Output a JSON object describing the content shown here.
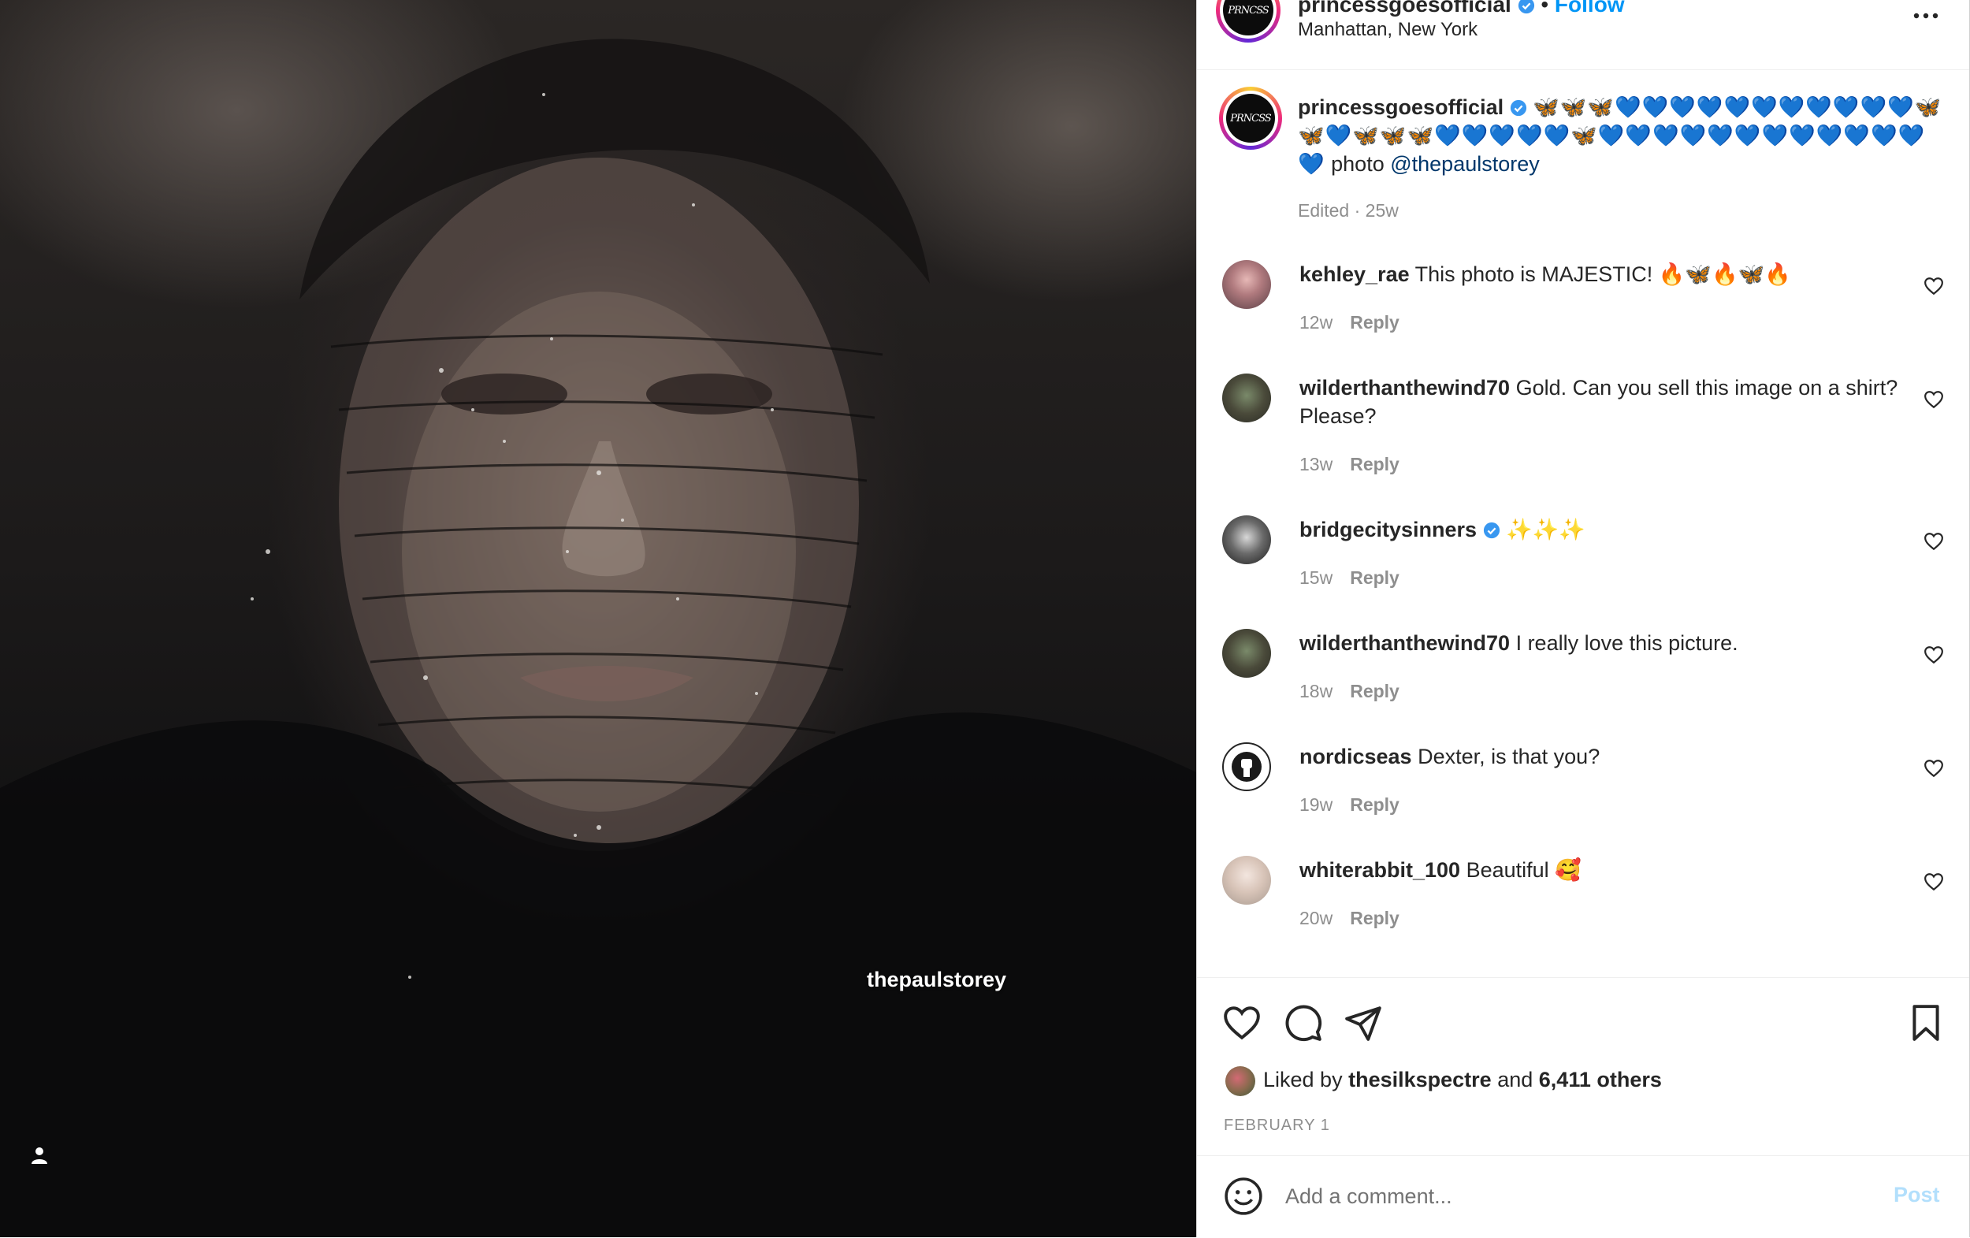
{
  "post": {
    "photo_credit": "thepaulstorey"
  },
  "author": {
    "username": "princessgoesofficial",
    "follow_label": "Follow",
    "location": "Manhattan, New York",
    "logo_text": "PRNCSS"
  },
  "caption": {
    "username": "princessgoesofficial",
    "emojis": "🦋🦋🦋💙💙💙💙💙💙💙💙💙💙💙🦋🦋💙🦋🦋🦋💙💙💙💙💙🦋💙💙💙💙💙💙💙💙💙💙💙💙💙",
    "text": "photo",
    "mention": "@thepaulstorey",
    "meta": "Edited · 25w"
  },
  "comments": [
    {
      "username": "kehley_rae",
      "text": "This photo is MAJESTIC! 🔥🦋🔥🦋🔥",
      "time": "12w",
      "reply": "Reply",
      "verified": false
    },
    {
      "username": "wilderthanthewind70",
      "text": "Gold. Can you sell this image on a shirt? Please?",
      "time": "13w",
      "reply": "Reply",
      "verified": false
    },
    {
      "username": "bridgecitysinners",
      "text": "✨✨✨",
      "time": "15w",
      "reply": "Reply",
      "verified": true
    },
    {
      "username": "wilderthanthewind70",
      "text": "I really love this picture.",
      "time": "18w",
      "reply": "Reply",
      "verified": false
    },
    {
      "username": "nordicseas",
      "text": "Dexter, is that you?",
      "time": "19w",
      "reply": "Reply",
      "verified": false
    },
    {
      "username": "whiterabbit_100",
      "text": "Beautiful 🥰",
      "time": "20w",
      "reply": "Reply",
      "verified": false
    }
  ],
  "likes": {
    "prefix": "Liked by",
    "user": "thesilkspectre",
    "joiner": "and",
    "others": "6,411 others"
  },
  "date": "FEBRUARY 1",
  "add_comment": {
    "placeholder": "Add a comment...",
    "post_label": "Post"
  },
  "colors": {
    "link": "#0095f6",
    "mention": "#00376b",
    "muted": "#8e8e8e",
    "post_disabled": "#b2dffc"
  },
  "icons": {
    "like": "heart-icon",
    "comment": "comment-bubble-icon",
    "share": "paper-plane-icon",
    "save": "bookmark-icon",
    "more": "ellipsis-icon",
    "emoji": "smiley-icon",
    "tag": "person-icon"
  }
}
